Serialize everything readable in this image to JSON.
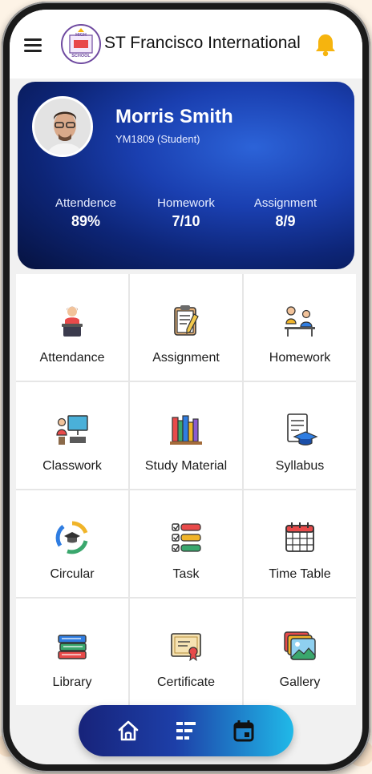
{
  "header": {
    "title": "ST Francisco International",
    "logo_text": [
      "HIGH",
      "SCHOOL"
    ],
    "menu_icon": "hamburger-menu-icon",
    "notification_icon": "bell-icon"
  },
  "profile": {
    "name": "Morris Smith",
    "id_line": "YM1809 (Student)",
    "stats": [
      {
        "label": "Attendence",
        "value": "89%"
      },
      {
        "label": "Homework",
        "value": "7/10"
      },
      {
        "label": "Assignment",
        "value": "8/9"
      }
    ]
  },
  "modules": [
    {
      "label": "Attendance",
      "icon": "teacher-at-podium-icon"
    },
    {
      "label": "Assignment",
      "icon": "clipboard-pencil-icon"
    },
    {
      "label": "Homework",
      "icon": "student-at-desk-icon"
    },
    {
      "label": "Classwork",
      "icon": "teacher-board-icon"
    },
    {
      "label": "Study Material",
      "icon": "books-icon"
    },
    {
      "label": "Syllabus",
      "icon": "document-grad-cap-icon"
    },
    {
      "label": "Circular",
      "icon": "graduation-cycle-icon"
    },
    {
      "label": "Task",
      "icon": "checklist-icon"
    },
    {
      "label": "Time Table",
      "icon": "calendar-grid-icon"
    },
    {
      "label": "Library",
      "icon": "book-stack-icon"
    },
    {
      "label": "Certificate",
      "icon": "certificate-icon"
    },
    {
      "label": "Gallery",
      "icon": "photo-gallery-icon"
    }
  ],
  "bottom_nav": [
    {
      "icon": "home-icon"
    },
    {
      "icon": "list-icon"
    },
    {
      "icon": "calendar-icon"
    }
  ],
  "colors": {
    "accent_yellow": "#f6b40e",
    "card_dark": "#06123f",
    "card_bright": "#2c63d8",
    "nav_start": "#17237a",
    "nav_end": "#20b9e8"
  }
}
